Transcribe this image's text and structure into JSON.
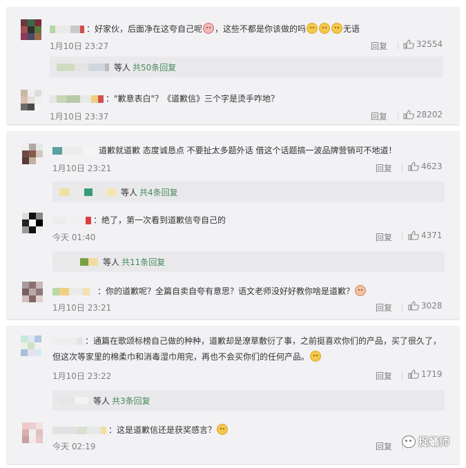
{
  "actions": {
    "reply_label": "回复"
  },
  "panels": [
    {
      "comments": [
        {
          "text": "：好家伙，后面净在这夸自己呢",
          "text_after": "，这些不都是你该做的吗",
          "text_tail": "无语",
          "time": "1月10日 23:27",
          "likes": "32554",
          "reply_bar": {
            "who": "等人",
            "count": "共50条回复"
          }
        },
        {
          "text": "：\"歉意表白\"？《道歉信》三个字是烫手咋地？",
          "time": "1月10日 23:37",
          "likes": "28202"
        }
      ]
    },
    {
      "comments": [
        {
          "text": "道歉就道歉 态度诚恳点 不要扯太多题外话 借这个话题搞一波品牌营销可不地道！",
          "time": "1月10日 23:21",
          "likes": "4623",
          "reply_bar": {
            "who": "等人",
            "count": "共4条回复"
          }
        },
        {
          "text": "：绝了，第一次看到道歉信夸自己的",
          "time": "今天 01:40",
          "likes": "4371",
          "reply_bar": {
            "who": "等人",
            "count": "共11条回复"
          }
        },
        {
          "text": "：你的道歉呢？全篇自卖自夸有意思？语文老师没好好教你啥是道歉？",
          "time": "1月10日 23:21",
          "likes": "3028"
        }
      ]
    },
    {
      "comments": [
        {
          "text": "：通篇在歌颂标榜自己做的种种，道歉却是潦草敷衍了事，之前挺喜欢你们的产品，买了很久了，但这次等家里的棉柔巾和消毒湿巾用完，再也不会买你们的任何产品。",
          "time": "1月10日 23:22",
          "likes": "1719",
          "reply_bar": {
            "who": "等人",
            "count": "共3条回复"
          }
        },
        {
          "text": "：这是道歉信还是获奖感言？",
          "time": "今天 02:19",
          "likes": ""
        }
      ]
    }
  ],
  "watermark": "捉蛹师",
  "icons": {
    "thumb": "thumbs-up-icon",
    "emoji": "face-emoji-icon",
    "watermark": "wechat-icon"
  },
  "colors": {
    "panel_bg": "#f2f2f5",
    "reply_bar_bg": "#e9e9ec",
    "reply_count": "#4a8a5c",
    "meta": "#808080"
  }
}
